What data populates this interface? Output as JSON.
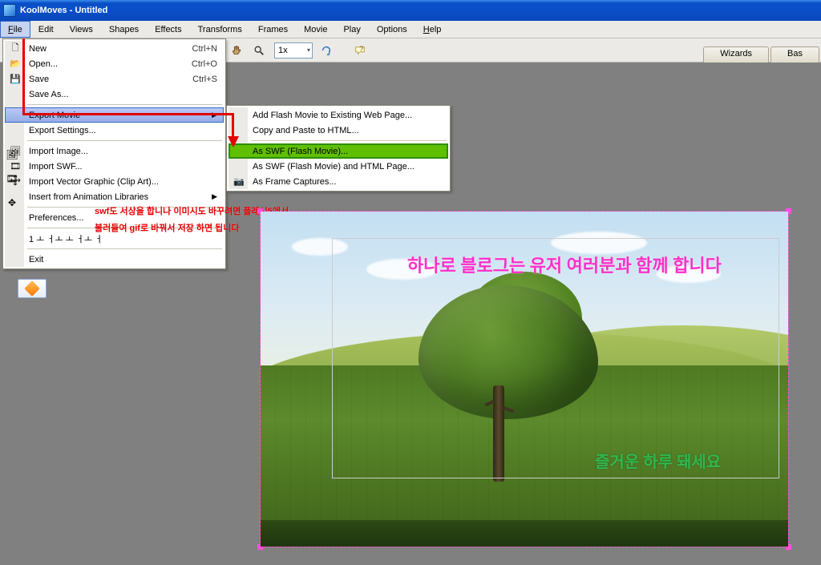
{
  "window": {
    "title": "KoolMoves - Untitled"
  },
  "menubar": {
    "file": "File",
    "edit": "Edit",
    "views": "Views",
    "shapes": "Shapes",
    "effects": "Effects",
    "transforms": "Transforms",
    "frames": "Frames",
    "movie": "Movie",
    "play": "Play",
    "options": "Options",
    "help": "Help"
  },
  "toolbar": {
    "zoom": "1x"
  },
  "tabs": {
    "wizards": "Wizards",
    "bas": "Bas"
  },
  "filemenu": {
    "new": "New",
    "new_sc": "Ctrl+N",
    "open": "Open...",
    "open_sc": "Ctrl+O",
    "save": "Save",
    "save_sc": "Ctrl+S",
    "saveas": "Save As...",
    "export_movie": "Export Movie",
    "export_settings": "Export Settings...",
    "import_image": "Import Image...",
    "import_swf": "Import SWF...",
    "import_vector": "Import Vector Graphic (Clip Art)...",
    "anim_libs": "Insert from Animation Libraries",
    "prefs": "Preferences...",
    "recent": "1 ㅗ ㅓㅗ ㅗ ㅓㅗ ㅓ",
    "exit": "Exit"
  },
  "submenu": {
    "add_existing": "Add Flash Movie to Existing Web Page...",
    "copy_html": "Copy and Paste to HTML...",
    "as_swf": "As SWF (Flash Movie)...",
    "as_swf_html": "As SWF (Flash Movie) and HTML Page...",
    "as_frame": "As Frame Captures..."
  },
  "annotation": {
    "line1": "swf도 서상을 합니나 이미시도 바꾸려면 플래시5에서",
    "line2": "불러들여 gif로 바꿔서 저장 하면 됩니다"
  },
  "overlay": {
    "pink": "하나로 블로그는 유저 여러분과 함께 합니다",
    "green": "즐거운 하루 돼세요"
  }
}
